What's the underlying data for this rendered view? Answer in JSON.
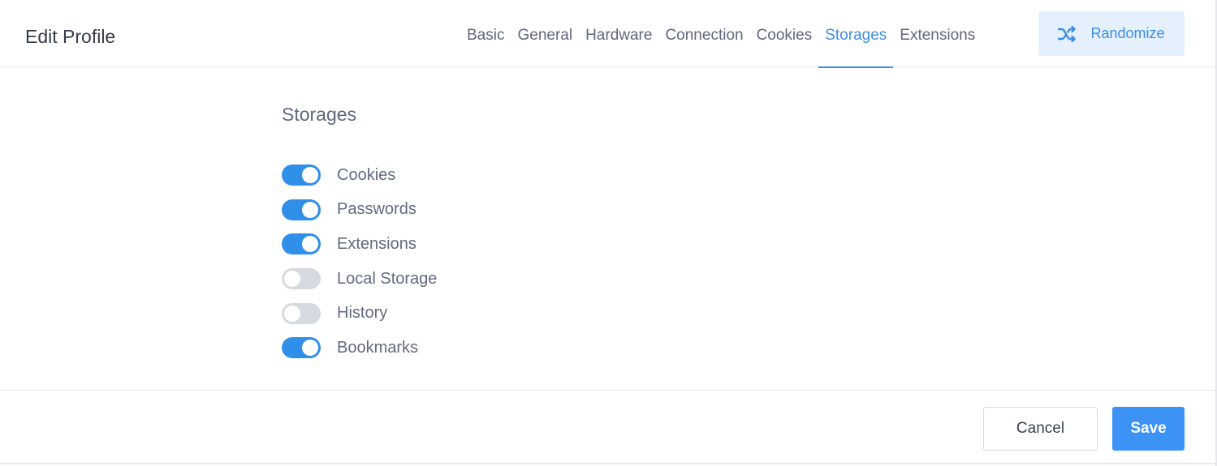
{
  "header": {
    "title": "Edit Profile",
    "tabs": [
      {
        "label": "Basic",
        "active": false
      },
      {
        "label": "General",
        "active": false
      },
      {
        "label": "Hardware",
        "active": false
      },
      {
        "label": "Connection",
        "active": false
      },
      {
        "label": "Cookies",
        "active": false
      },
      {
        "label": "Storages",
        "active": true
      },
      {
        "label": "Extensions",
        "active": false
      }
    ],
    "randomize": {
      "label": "Randomize",
      "icon": "shuffle-icon"
    }
  },
  "storages": {
    "title": "Storages",
    "items": [
      {
        "label": "Cookies",
        "enabled": true
      },
      {
        "label": "Passwords",
        "enabled": true
      },
      {
        "label": "Extensions",
        "enabled": true
      },
      {
        "label": "Local Storage",
        "enabled": false
      },
      {
        "label": "History",
        "enabled": false
      },
      {
        "label": "Bookmarks",
        "enabled": true
      }
    ]
  },
  "footer": {
    "cancel_label": "Cancel",
    "save_label": "Save"
  },
  "colors": {
    "accent": "#3d8ee6",
    "toggle_on": "#2f8fe9",
    "toggle_off": "#d6d9df",
    "save_button": "#3d93f5",
    "randomize_bg": "#e4f0fc"
  }
}
